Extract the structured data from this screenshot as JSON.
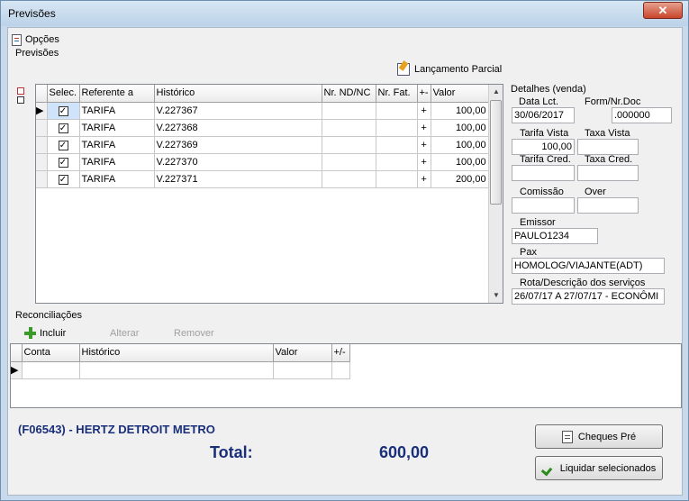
{
  "window": {
    "title": "Previsões",
    "close": "✕"
  },
  "menu": {
    "opcoes": "Opções"
  },
  "groups": {
    "previsoes": "Previsões",
    "detalhes": "Detalhes (venda)",
    "reconciliacoes": "Reconciliações"
  },
  "toolbar": {
    "lancamento_parcial": "Lançamento Parcial"
  },
  "previsoes_table": {
    "columns": [
      "Selec.",
      "Referente a",
      "Histórico",
      "Nr. ND/NC",
      "Nr. Fat.",
      "+-",
      "Valor"
    ],
    "rows": [
      {
        "selec": "✓",
        "referente": "TARIFA",
        "historico": "V.227367",
        "nd": "",
        "fat": "",
        "sinal": "+",
        "valor": "100,00"
      },
      {
        "selec": "✓",
        "referente": "TARIFA",
        "historico": "V.227368",
        "nd": "",
        "fat": "",
        "sinal": "+",
        "valor": "100,00"
      },
      {
        "selec": "✓",
        "referente": "TARIFA",
        "historico": "V.227369",
        "nd": "",
        "fat": "",
        "sinal": "+",
        "valor": "100,00"
      },
      {
        "selec": "✓",
        "referente": "TARIFA",
        "historico": "V.227370",
        "nd": "",
        "fat": "",
        "sinal": "+",
        "valor": "100,00"
      },
      {
        "selec": "✓",
        "referente": "TARIFA",
        "historico": "V.227371",
        "nd": "",
        "fat": "",
        "sinal": "+",
        "valor": "200,00"
      }
    ]
  },
  "detalhes": {
    "data_lct_label": "Data Lct.",
    "data_lct": "30/06/2017",
    "form_doc_label": "Form/Nr.Doc",
    "form_doc": ".000000",
    "tarifa_vista_label": "Tarifa Vista",
    "tarifa_vista": "100,00",
    "taxa_vista_label": "Taxa Vista",
    "taxa_vista": "",
    "tarifa_cred_label": "Tarifa Cred.",
    "tarifa_cred": "",
    "taxa_cred_label": "Taxa Cred.",
    "taxa_cred": "",
    "comissao_label": "Comissão",
    "comissao": "",
    "over_label": "Over",
    "over": "",
    "emissor_label": "Emissor",
    "emissor": "PAULO1234",
    "pax_label": "Pax",
    "pax": "HOMOLOG/VIAJANTE(ADT)",
    "rota_label": "Rota/Descrição dos serviços",
    "rota": "26/07/17 A 27/07/17 - ECONÔMI"
  },
  "reconciliacoes": {
    "incluir": "Incluir",
    "alterar": "Alterar",
    "remover": "Remover",
    "columns": [
      "Conta",
      "Histórico",
      "Valor",
      "+/-"
    ]
  },
  "footer": {
    "company": "(F06543) - HERTZ DETROIT METRO",
    "total_label": "Total:",
    "total_value": "600,00",
    "cheques_pre": "Cheques Pré",
    "liquidar": "Liquidar selecionados"
  },
  "colors": {
    "accent": "#1a2f7a",
    "window_frame": "#c7d9ea"
  }
}
